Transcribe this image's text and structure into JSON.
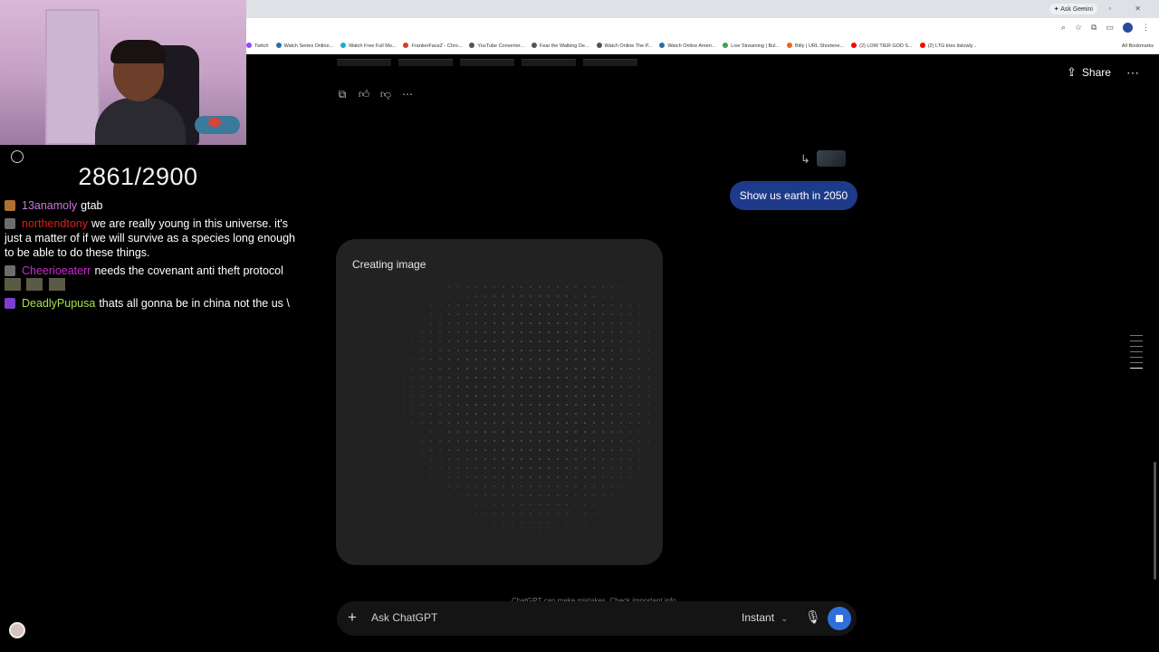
{
  "stream": {
    "counter": "2861/2900",
    "chat": [
      {
        "user": "13anamoly",
        "color": "#c67ad6",
        "badge_color": "#b07030",
        "text": "gtab"
      },
      {
        "user": "northendtony",
        "color": "#e21c1c",
        "badge_color": "#6d6d6d",
        "text": "we are really young in this universe. it's just a matter of if we will survive as a species long enough to be able to do these things."
      },
      {
        "user": "Cheerioeaterr",
        "color": "#cc2ad2",
        "badge_color": "#6d6d6d",
        "text": "needs the covenant anti theft protocol"
      },
      {
        "user": "DeadlyPupusa",
        "color": "#a6e24a",
        "badge_color": "#7a3fd0",
        "text": "thats all gonna be in china not the us \\"
      }
    ]
  },
  "browser": {
    "ask_gemini": "✦ Ask Gemini",
    "window_controls": "– ▫ ✕",
    "bookmarks": [
      {
        "label": "Twitch",
        "color": "#9146ff"
      },
      {
        "label": "Watch Series Online...",
        "color": "#2a6fa8"
      },
      {
        "label": "Watch Free Full Mo...",
        "color": "#15b1c9"
      },
      {
        "label": "FrankerFaceZ - Chro...",
        "color": "#d83a2a"
      },
      {
        "label": "YouTube Converter...",
        "color": "#555555"
      },
      {
        "label": "Fear the Walking De...",
        "color": "#555555"
      },
      {
        "label": "Watch Online The P...",
        "color": "#555555"
      },
      {
        "label": "Watch Online Ameri...",
        "color": "#2a6fa8"
      },
      {
        "label": "Live Streaming | Bul...",
        "color": "#3fa34d"
      },
      {
        "label": "Bitly | URL Shortene...",
        "color": "#ee6123"
      },
      {
        "label": "(2) LOW TIER GOD S...",
        "color": "#ff0000"
      },
      {
        "label": "(2) LTG tries itslowly...",
        "color": "#ff0000"
      }
    ],
    "all_bookmarks": "All Bookmarks"
  },
  "chatgpt": {
    "share_label": "Share",
    "user_message": "Show us earth in 2050",
    "generating_label": "Creating image",
    "disclaimer": "ChatGPT can make mistakes. Check important info.",
    "composer_placeholder": "Ask ChatGPT",
    "model_label": "Instant"
  }
}
